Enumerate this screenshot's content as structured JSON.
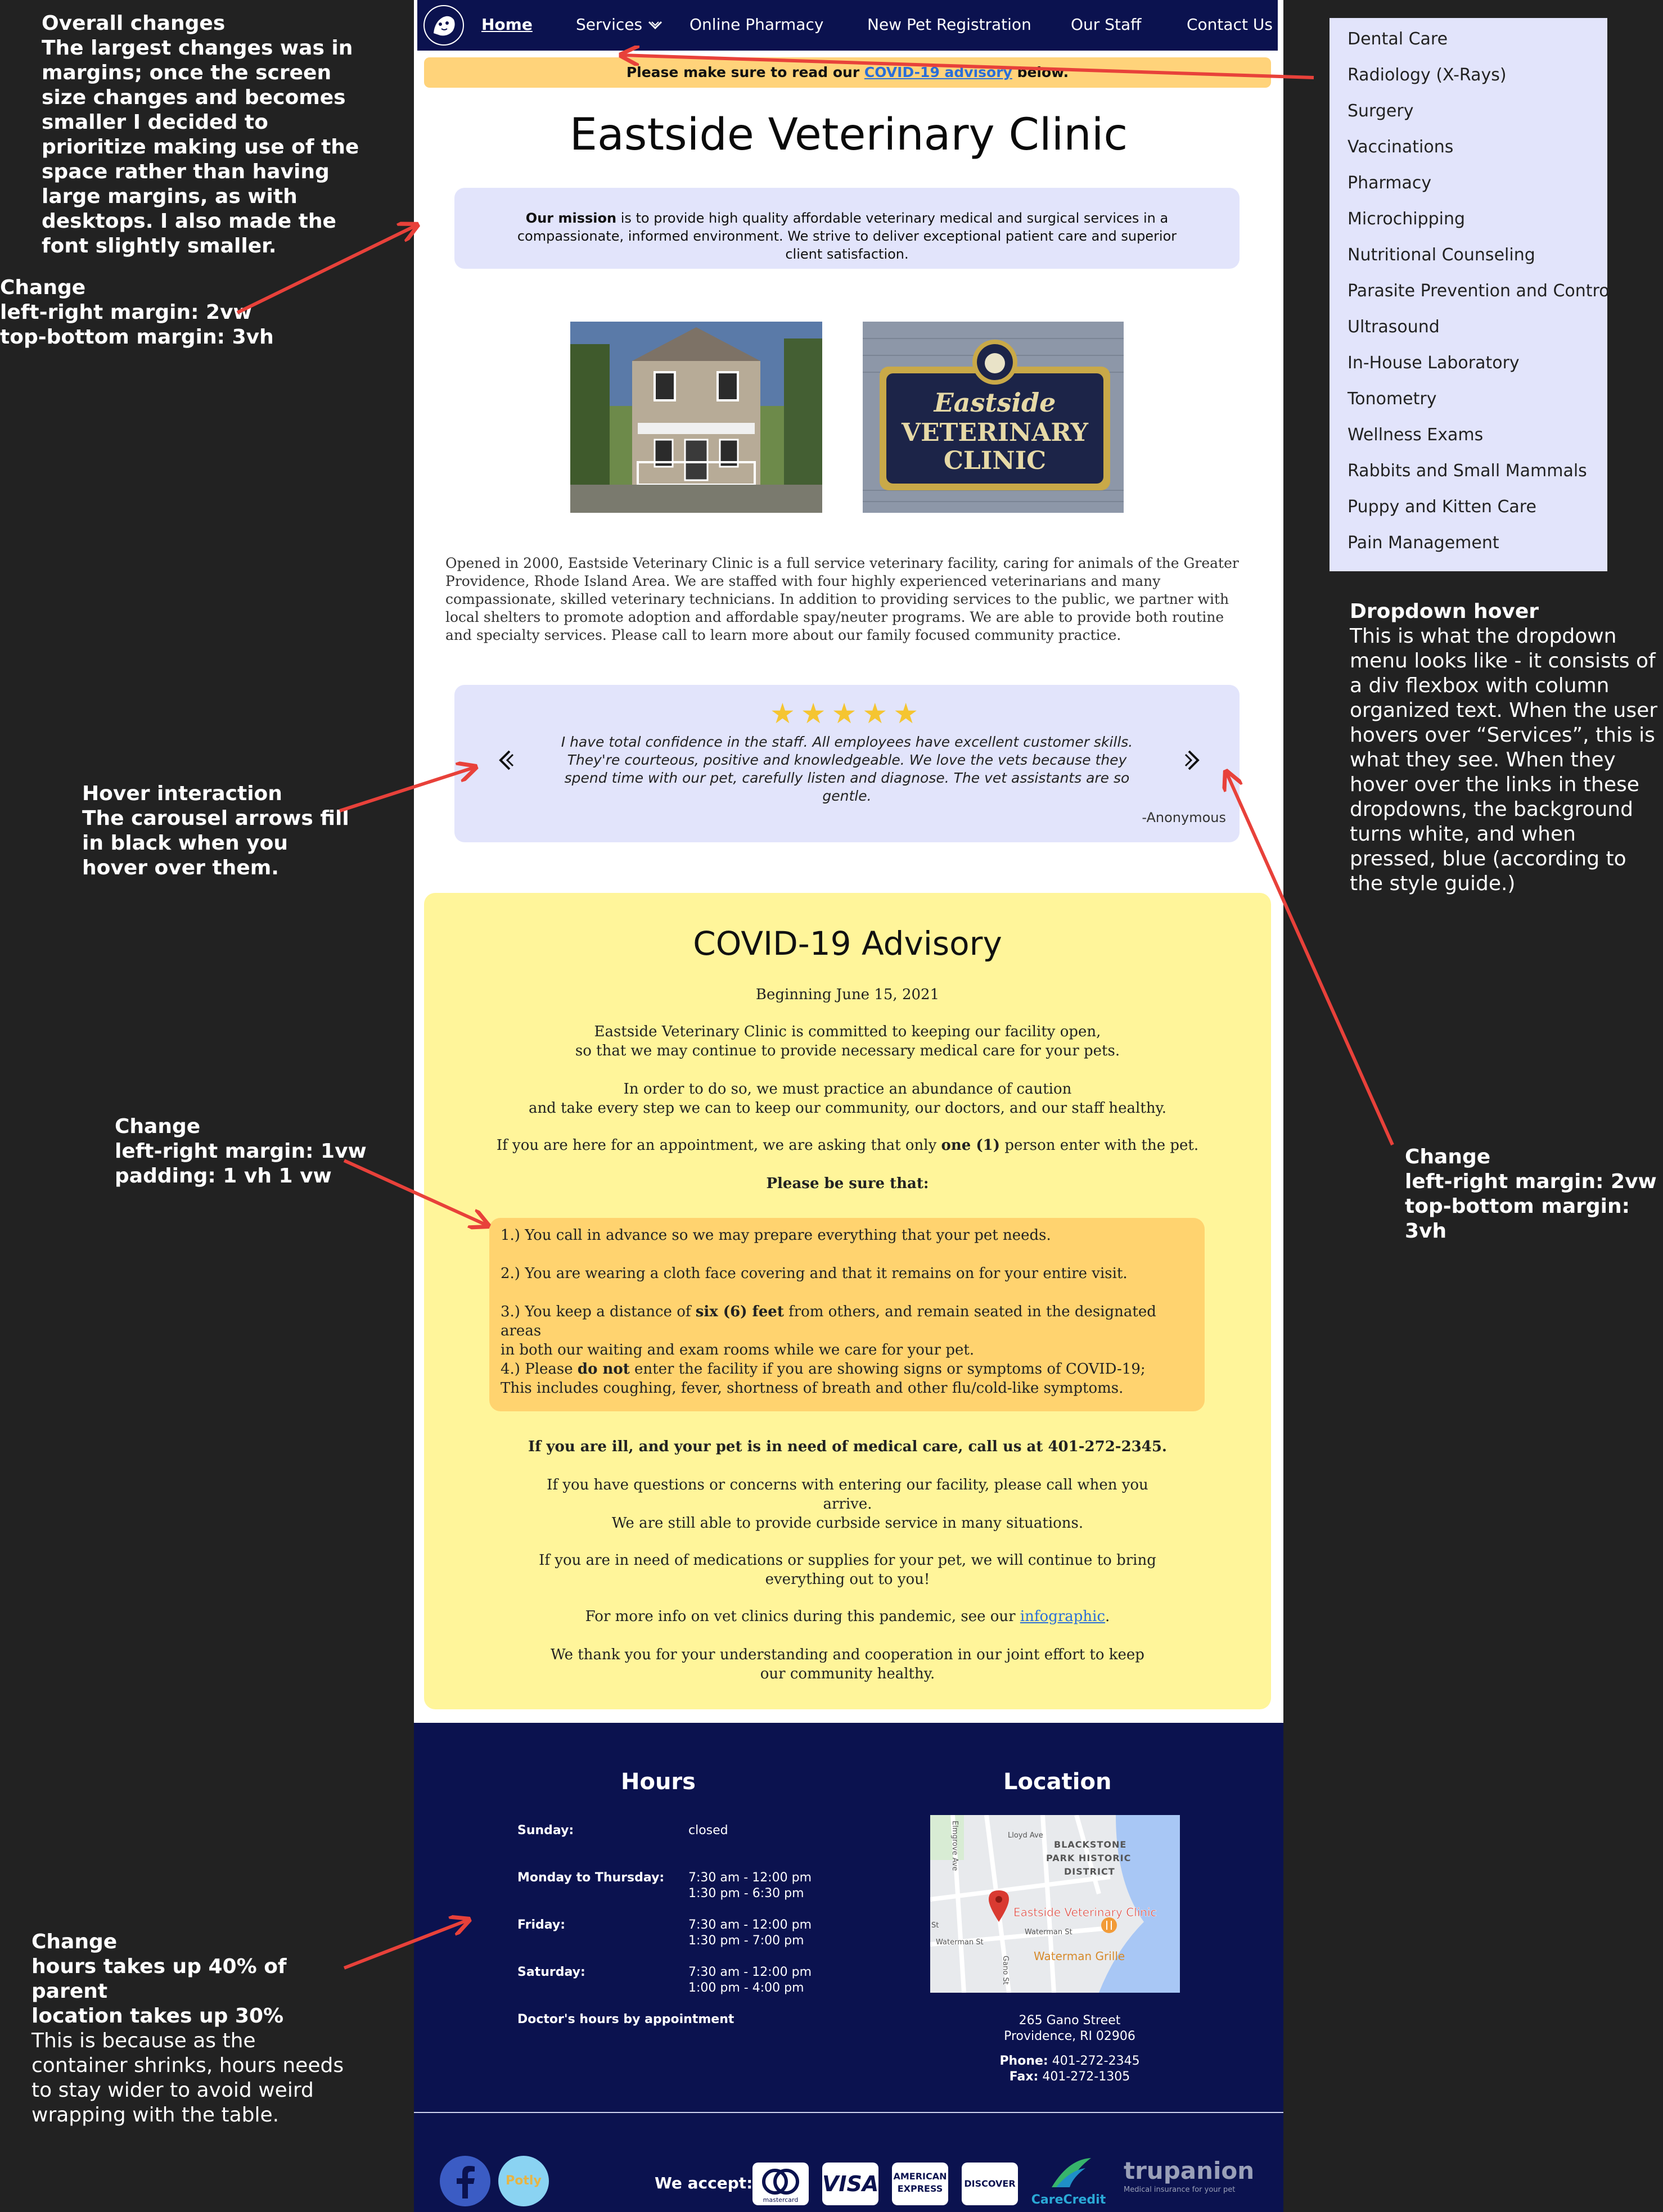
{
  "annotations": {
    "overall": {
      "title": "Overall changes",
      "body": "The largest changes was in margins; once the screen size changes and becomes smaller I decided to prioritize making use of the space rather than having large margins, as with desktops. I also made the font slightly smaller."
    },
    "margin_change_1": {
      "l1": "Change",
      "l2": "left-right margin: 2vw",
      "l3": "top-bottom margin: 3vh"
    },
    "hover": {
      "title": "Hover interaction",
      "body": "The carousel arrows fill in black when you hover over them."
    },
    "covid_change": {
      "l1": "Change",
      "l2": "left-right margin: 1vw",
      "l3": "padding: 1 vh 1 vw"
    },
    "hours_change": {
      "l1": "Change",
      "l2": "hours takes up 40% of parent",
      "l3": "location takes up 30%",
      "body": "This is because as the container shrinks, hours needs to stay wider to avoid weird wrapping with the table."
    },
    "dropdown_hover": {
      "title": "Dropdown hover",
      "body": "This is what the dropdown menu looks like - it consists of a div flexbox with column organized text. When the user hovers over “Services”, this is what they see. When they hover over the links in these dropdowns, the background turns white, and when pressed, blue (according to the style guide.)"
    },
    "margin_change_2": {
      "l1": "Change",
      "l2": "left-right margin: 2vw",
      "l3": "top-bottom margin: 3vh"
    }
  },
  "nav": {
    "items": [
      "Home",
      "Services",
      "Online Pharmacy",
      "New Pet Registration",
      "Our Staff",
      "Contact Us"
    ],
    "active": "Home"
  },
  "notice": {
    "pre": "Please make sure to read our ",
    "link": "COVID-19 advisory",
    "post": " below."
  },
  "clinic_name": "Eastside Veterinary Clinic",
  "mission": {
    "lead": "Our mission",
    "text": " is to provide high quality affordable veterinary medical and surgical services in a compassionate, informed environment. We strive to deliver exceptional patient care and superior client satisfaction."
  },
  "sign_text": {
    "l1": "Eastside",
    "l2": "VETERINARY",
    "l3": "CLINIC"
  },
  "about": "Opened in 2000, Eastside Veterinary Clinic is a full service veterinary facility, caring for animals of the Greater Providence, Rhode Island Area. We are staffed with four highly experienced veterinarians and many compassionate, skilled veterinary technicians. In addition to providing services to the public, we partner with local shelters to promote adoption and affordable spay/neuter programs. We are able to provide both routine and specialty services. Please call to learn more about our family focused  community practice.",
  "review": {
    "rating": 5,
    "stars": "★★★★★",
    "quote": "I have total confidence in the staff. All employees have excellent customer skills. They're courteous, positive and knowledgeable. We love the vets because they spend time with our pet, carefully listen and diagnose. The vet assistants are so gentle.",
    "author": "-Anonymous"
  },
  "covid": {
    "title": "COVID-19 Advisory",
    "date": "Beginning June 15, 2021",
    "p1a": "Eastside Veterinary Clinic is committed to keeping our facility open,",
    "p1b": "so that we may continue to provide necessary medical care for your pets.",
    "p2a": "In order to do so, we must practice an abundance of caution",
    "p2b": "and take every step we can to keep our community, our doctors, and our staff healthy.",
    "p3a": "If you are here for an appointment, we are asking that only ",
    "p3b": "one (1)",
    "p3c": " person enter with the pet.",
    "be_sure": "Please be sure that:",
    "list": {
      "i1": "1.) You call in advance so we may prepare everything that your pet needs.",
      "i2": "2.) You are wearing a cloth face covering and that it remains on for your entire visit.",
      "i3a": "3.) You keep a distance of ",
      "i3b": "six (6) feet",
      "i3c": " from others, and remain seated in the designated areas",
      "i3d": "in both our waiting and exam rooms while we care for your pet.",
      "i4a": "4.) Please ",
      "i4b": "do not",
      "i4c": " enter the facility if you are showing signs or symptoms of COVID-19;",
      "i4d": "This includes coughing, fever, shortness of  breath and other flu/cold-like symptoms."
    },
    "ill": "If you are ill, and your pet is in need of medical care, call us at 401-272-2345.",
    "q1": "If you have questions or concerns with entering our facility, please call when you",
    "q2": "arrive.",
    "q3": "We are still able to provide curbside service in many situations.",
    "m1": "If you are in need of medications or supplies for your pet, we will continue to bring",
    "m2": "everything out to you!",
    "info_pre": "For more info on vet clinics during this pandemic, see our ",
    "info_link": "infographic",
    "info_post": ".",
    "thanks1": "We thank you for your understanding and cooperation in our joint effort to keep",
    "thanks2": "our community healthy."
  },
  "footer": {
    "hours_title": "Hours",
    "location_title": "Location",
    "hours": [
      {
        "day": "Sunday:",
        "l1": "closed",
        "l2": ""
      },
      {
        "day": "Monday to Thursday:",
        "l1": "7:30 am - 12:00 pm",
        "l2": "1:30 pm - 6:30 pm"
      },
      {
        "day": "Friday:",
        "l1": "7:30 am - 12:00 pm",
        "l2": "1:30 pm - 7:00 pm"
      },
      {
        "day": "Saturday:",
        "l1": "7:30 am - 12:00 pm",
        "l2": "1:00 pm - 4:00 pm"
      }
    ],
    "doctor_note": "Doctor's hours by appointment",
    "map": {
      "district_l1": "BLACKSTONE",
      "district_l2": "PARK HISTORIC",
      "district_l3": "DISTRICT",
      "pin_label": "Eastside Veterinary Clinic",
      "grille": "Waterman Grille",
      "st1": "Waterman St",
      "st2": "Waterman St",
      "st3": "Lloyd Ave",
      "st4": "Gano St",
      "st5": "Elmgrove Ave",
      "st6": "St"
    },
    "address_l1": "265 Gano Street",
    "address_l2": "Providence, RI  02906",
    "phone_label": "Phone:",
    "phone": " 401-272-2345",
    "fax_label": "Fax:",
    "fax": " 401-272-1305",
    "we_accept": "We accept:",
    "social": {
      "potly": "Potly"
    },
    "payments": {
      "visa": "VISA",
      "amex1": "AMERICAN",
      "amex2": "EXPRESS",
      "discover": "DISCOVER",
      "carecredit": "CareCredit",
      "mastercard": "mastercard",
      "trupanion": "trupanion",
      "trupanion_tag": "Medical insurance for your pet"
    }
  },
  "dropdown": {
    "items": [
      "Dental Care",
      "Radiology (X-Rays)",
      "Surgery",
      "Vaccinations",
      "Pharmacy",
      "Microchipping",
      "Nutritional Counseling",
      "Parasite Prevention and Control",
      "Ultrasound",
      "In-House Laboratory",
      "Tonometry",
      "Wellness Exams",
      "Rabbits and Small Mammals",
      "Puppy and Kitten Care",
      "Pain Management"
    ]
  },
  "colors": {
    "navy": "#0b124f",
    "lavender": "#e2e4fb",
    "notice": "#ffd37a",
    "covid": "#fff59a",
    "covid_inner": "#ffd36f",
    "star": "#f5c531",
    "arrow": "#e8413a"
  }
}
